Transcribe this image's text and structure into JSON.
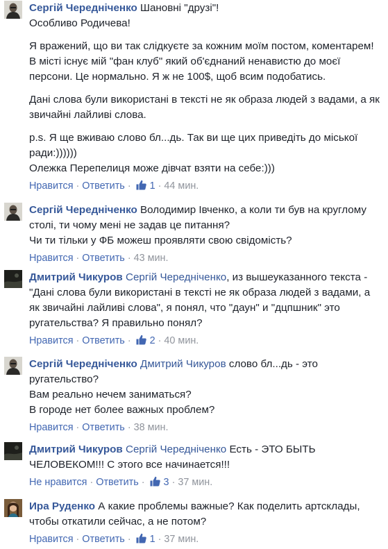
{
  "comments": [
    {
      "author": "Сергій Чередніченко",
      "mention": "",
      "paragraphs": [
        "Шановні \"друзі\"!\nОсобливо Родичева!",
        "Я вражений, що ви так слідкуєте за кожним моїм постом, коментарем! В місті існує мій \"фан клуб\" який об'єднаний ненавистю до моєї персони. Це нормально. Я ж не 100$, щоб всим подобатись.",
        "Дані слова були використані в тексті не як образа людей з вадами, а як звичайні лайливі слова.",
        "p.s. Я ще вживаю слово бл...дь. Так ви ще цих приведіть до міської ради:))))))\nОлежка Перепелиця може дівчат взяти на себе:)))"
      ],
      "like_label": "Нравится",
      "reply_label": "Ответить",
      "like_count": "1",
      "time": "44 мин.",
      "avatar": "man-icon"
    },
    {
      "author": "Сергій Чередніченко",
      "mention": "",
      "paragraphs": [
        "Володимир Івченко, а коли ти був на круглому столі, ти чому мені не задав це питання?\nЧи ти тільки у ФБ можеш проявляти свою свідомість?"
      ],
      "like_label": "Нравится",
      "reply_label": "Ответить",
      "like_count": "",
      "time": "43 мин.",
      "avatar": "man-icon"
    },
    {
      "author": "Дмитрий Чикуров",
      "mention": "Сергій Чередніченко",
      "paragraphs": [
        ", из вышеуказанного текста -\"Дані слова були використані в тексті не як образа людей з вадами, а як звичайні лайливі слова\", я понял, что \"даун\" и \"дцпшник\" это ругательства? Я правильно понял?"
      ],
      "like_label": "Нравится",
      "reply_label": "Ответить",
      "like_count": "2",
      "time": "40 мин.",
      "avatar": "dark-photo-icon"
    },
    {
      "author": "Сергій Чередніченко",
      "mention": "Дмитрий Чикуров",
      "paragraphs": [
        " слово бл...дь - это ругательство?\nВам реально нечем заниматься?\nВ городе нет более важных проблем?"
      ],
      "like_label": "Нравится",
      "reply_label": "Ответить",
      "like_count": "",
      "time": "38 мин.",
      "avatar": "man-icon"
    },
    {
      "author": "Дмитрий Чикуров",
      "mention": "Сергій Чередніченко",
      "paragraphs": [
        " Есть - ЭТО БЫТЬ ЧЕЛОВЕКОМ!!! С этого все начинается!!!"
      ],
      "like_label": "Не нравится",
      "reply_label": "Ответить",
      "like_count": "3",
      "time": "37 мин.",
      "avatar": "dark-photo-icon"
    },
    {
      "author": "Ира Руденко",
      "mention": "",
      "paragraphs": [
        "А какие проблемы важные? Как поделить артсклады, чтобы откатили сейчас, а не потом?"
      ],
      "like_label": "Нравится",
      "reply_label": "Ответить",
      "like_count": "1",
      "time": "37 мин.",
      "avatar": "woman-photo-icon"
    }
  ]
}
